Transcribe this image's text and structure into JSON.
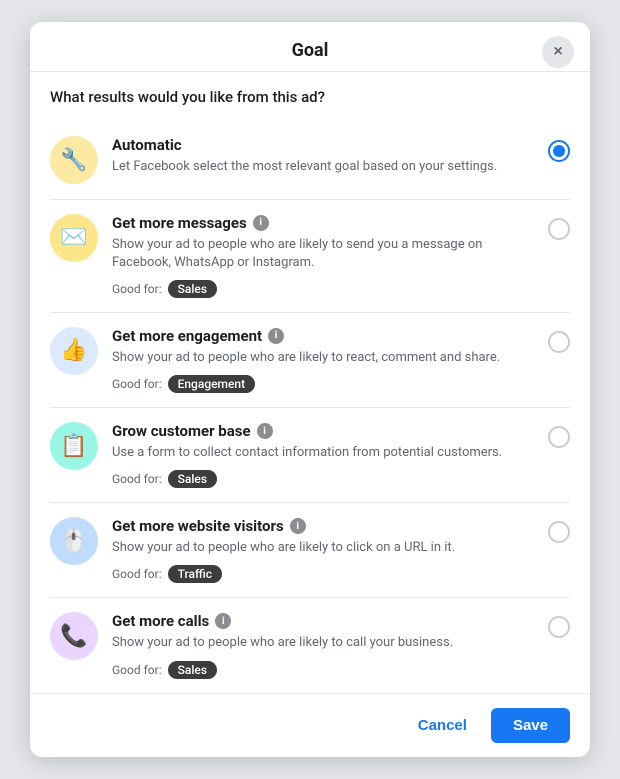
{
  "modal": {
    "title": "Goal",
    "question": "What results would you like from this ad?",
    "close_label": "×"
  },
  "goals": [
    {
      "id": "automatic",
      "name": "Automatic",
      "desc": "Let Facebook select the most relevant goal based on your settings.",
      "good_for_label": "",
      "tag": "",
      "icon_emoji": "🔧",
      "icon_class": "icon-automatic",
      "selected": true,
      "has_info": false
    },
    {
      "id": "messages",
      "name": "Get more messages",
      "desc": "Show your ad to people who are likely to send you a message on Facebook, WhatsApp or Instagram.",
      "good_for_label": "Good for:",
      "tag": "Sales",
      "icon_emoji": "✉️",
      "icon_class": "icon-messages",
      "selected": false,
      "has_info": true
    },
    {
      "id": "engagement",
      "name": "Get more engagement",
      "desc": "Show your ad to people who are likely to react, comment and share.",
      "good_for_label": "Good for:",
      "tag": "Engagement",
      "icon_emoji": "👍",
      "icon_class": "icon-engagement",
      "selected": false,
      "has_info": true
    },
    {
      "id": "customer",
      "name": "Grow customer base",
      "desc": "Use a form to collect contact information from potential customers.",
      "good_for_label": "Good for:",
      "tag": "Sales",
      "icon_emoji": "📋",
      "icon_class": "icon-customer",
      "selected": false,
      "has_info": true
    },
    {
      "id": "website",
      "name": "Get more website visitors",
      "desc": "Show your ad to people who are likely to click on a URL in it.",
      "good_for_label": "Good for:",
      "tag": "Traffic",
      "icon_emoji": "🖱️",
      "icon_class": "icon-website",
      "selected": false,
      "has_info": true
    },
    {
      "id": "calls",
      "name": "Get more calls",
      "desc": "Show your ad to people who are likely to call your business.",
      "good_for_label": "Good for:",
      "tag": "Sales",
      "icon_emoji": "📞",
      "icon_class": "icon-calls",
      "selected": false,
      "has_info": true
    }
  ],
  "footer": {
    "cancel_label": "Cancel",
    "save_label": "Save"
  }
}
